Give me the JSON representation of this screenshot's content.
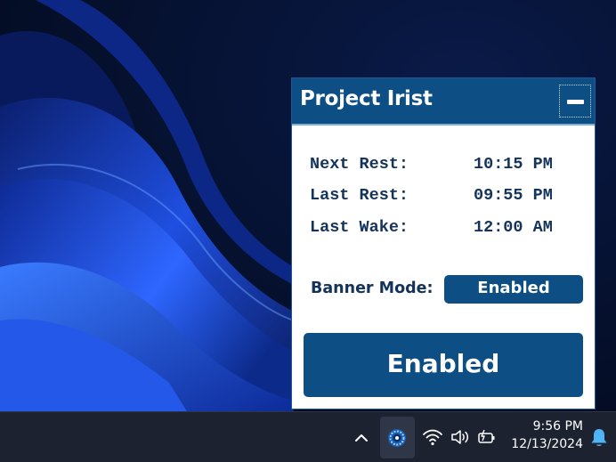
{
  "app": {
    "title": "Project Irist",
    "rows": [
      {
        "label": "Next Rest:",
        "value": "10:15 PM"
      },
      {
        "label": "Last Rest:",
        "value": "09:55 PM"
      },
      {
        "label": "Last Wake:",
        "value": "12:00 AM"
      }
    ],
    "banner_mode_label": "Banner Mode:",
    "banner_mode_value": "Enabled",
    "main_toggle_label": "Enabled"
  },
  "taskbar": {
    "time": "9:56 PM",
    "date": "12/13/2024",
    "tray_icons": [
      "chevron-up-icon",
      "project-irist-tray-icon",
      "wifi-icon",
      "volume-icon",
      "battery-icon",
      "notification-bell-icon"
    ]
  },
  "colors": {
    "accent": "#0d4f85",
    "text_dark": "#14335a",
    "taskbar": "#1c2230",
    "bell": "#4fb4f5"
  }
}
